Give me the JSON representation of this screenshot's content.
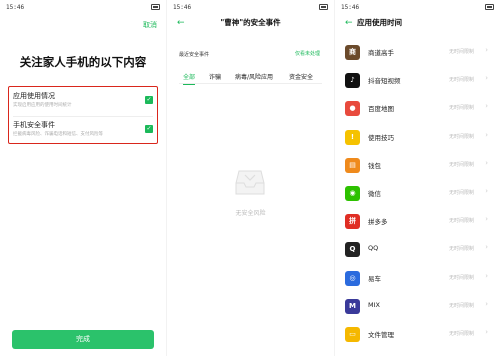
{
  "screen1": {
    "status_time": "15:46",
    "cancel_label": "取消",
    "title": "关注家人手机的以下内容",
    "options": [
      {
        "label": "应用使用情况",
        "desc": "实现启用应用的使用时间统计"
      },
      {
        "label": "手机安全事件",
        "desc": "拦截病毒风险、诈骗电话和短信、支付风险等"
      }
    ],
    "checkmark": "✓",
    "done_label": "完成"
  },
  "screen2": {
    "status_time": "15:46",
    "back_glyph": "←",
    "title": "\"曹神\"的安全事件",
    "subtitle": "最近安全事件",
    "sub_link": "仅看未处理",
    "tabs": [
      "全部",
      "诈骗",
      "病毒/风险应用",
      "资金安全"
    ],
    "empty_text": "无安全风险"
  },
  "screen3": {
    "status_time": "15:46",
    "back_glyph": "←",
    "title": "应用使用时间",
    "limit_label": "无时间限制",
    "chevron": "›",
    "apps": [
      {
        "name": "商道高手",
        "icon": "business-game-icon",
        "color": "#6b4a2b",
        "glyph": "商"
      },
      {
        "name": "抖音短视频",
        "icon": "douyin-icon",
        "color": "#111111",
        "glyph": "♪"
      },
      {
        "name": "百度地图",
        "icon": "baidu-map-icon",
        "color": "#e84a3d",
        "glyph": "●"
      },
      {
        "name": "使用技巧",
        "icon": "tips-icon",
        "color": "#f5c200",
        "glyph": "!"
      },
      {
        "name": "钱包",
        "icon": "wallet-icon",
        "color": "#ef8a1c",
        "glyph": "▤"
      },
      {
        "name": "微信",
        "icon": "wechat-icon",
        "color": "#2dc100",
        "glyph": "◉"
      },
      {
        "name": "拼多多",
        "icon": "pinduoduo-icon",
        "color": "#e02e24",
        "glyph": "拼"
      },
      {
        "name": "QQ",
        "icon": "qq-icon",
        "color": "#222222",
        "glyph": "Q"
      },
      {
        "name": "易车",
        "icon": "yiche-icon",
        "color": "#2b6bde",
        "glyph": "◎"
      },
      {
        "name": "MIX",
        "icon": "mix-icon",
        "color": "#3a3a9a",
        "glyph": "M"
      },
      {
        "name": "文件管理",
        "icon": "file-manager-icon",
        "color": "#f5b800",
        "glyph": "▭"
      }
    ]
  }
}
